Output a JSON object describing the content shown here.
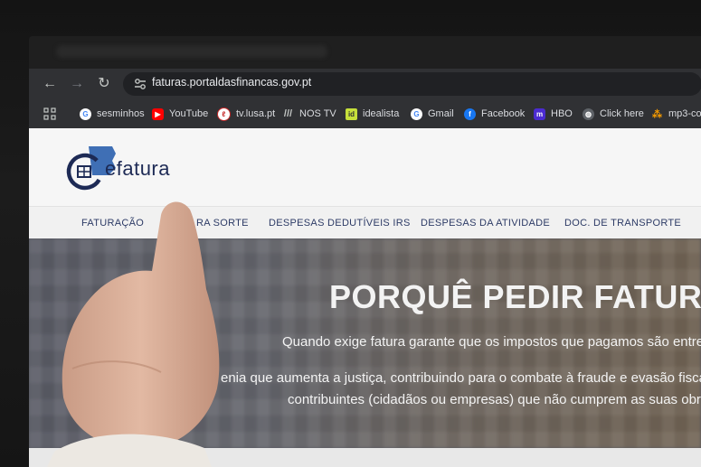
{
  "browser": {
    "url": "faturas.portaldasfinancas.gov.pt",
    "bookmarks": [
      {
        "label": "sesminhos",
        "icon": "google-icon",
        "color": "#ffffff"
      },
      {
        "label": "YouTube",
        "icon": "youtube-icon",
        "color": "#ff0000"
      },
      {
        "label": "tv.lusa.pt",
        "icon": "lusa-icon",
        "color": "#c62828"
      },
      {
        "label": "NOS TV",
        "icon": "nos-icon",
        "color": "#9e9e9e"
      },
      {
        "label": "idealista",
        "icon": "idealista-icon",
        "color": "#c6e03b"
      },
      {
        "label": "Gmail",
        "icon": "google-icon",
        "color": "#ffffff"
      },
      {
        "label": "Facebook",
        "icon": "facebook-icon",
        "color": "#1877f2"
      },
      {
        "label": "HBO",
        "icon": "hbo-icon",
        "color": "#4b2bd1"
      },
      {
        "label": "Click here",
        "icon": "globe-icon",
        "color": "#9aa0a6"
      },
      {
        "label": "mp3-co",
        "icon": "mp3-icon",
        "color": "#f29900"
      }
    ]
  },
  "site": {
    "logo_text": "efatura",
    "nav": [
      "FATURAÇÃO",
      "RA SORTE",
      "DESPESAS DEDUTÍVEIS IRS",
      "DESPESAS DA ATIVIDADE",
      "DOC. DE TRANSPORTE"
    ],
    "hero": {
      "title": "PORQUÊ PEDIR FATURA",
      "lines": [
        "Quando exige fatura garante que os impostos que pagamos são entregue",
        "enia que aumenta a justiça, contribuindo para o combate à fraude e evasão fiscal. Nã",
        "contribuintes (cidadãos ou empresas) que não cumprem as suas obrigaç"
      ]
    }
  },
  "colors": {
    "brand_navy": "#1d2a55",
    "brand_blue": "#3f6fb5"
  }
}
